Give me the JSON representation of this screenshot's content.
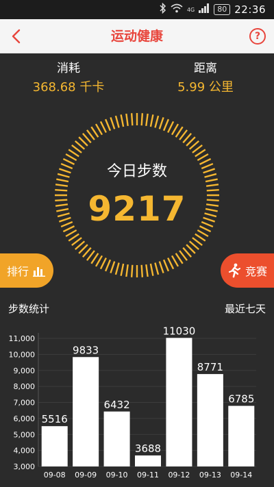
{
  "status_bar": {
    "network": "4G",
    "battery": "80",
    "time": "22:36"
  },
  "header": {
    "title": "运动健康",
    "help_label": "?"
  },
  "stats": {
    "calories_label": "消耗",
    "calories_value": "368.68 千卡",
    "distance_label": "距离",
    "distance_value": "5.99 公里"
  },
  "ring": {
    "label": "今日步数",
    "steps": "9217",
    "accent_color": "#f5b731"
  },
  "buttons": {
    "rank_label": "排行",
    "race_label": "竞赛",
    "rank_color": "#f1a428",
    "race_color": "#ec4f2d"
  },
  "section": {
    "title": "步数统计",
    "range": "最近七天"
  },
  "chart_data": {
    "type": "bar",
    "categories": [
      "09-08",
      "09-09",
      "09-10",
      "09-11",
      "09-12",
      "09-13",
      "09-14"
    ],
    "values": [
      5516,
      9833,
      6432,
      3688,
      11030,
      8771,
      6785
    ],
    "ylim": [
      3000,
      11000
    ],
    "yticks": [
      "3,000",
      "4,000",
      "5,000",
      "6,000",
      "7,000",
      "8,000",
      "9,000",
      "10,000",
      "11,000"
    ],
    "ytick_values": [
      3000,
      4000,
      5000,
      6000,
      7000,
      8000,
      9000,
      10000,
      11000
    ],
    "grid": true,
    "bar_color": "#ffffff"
  }
}
